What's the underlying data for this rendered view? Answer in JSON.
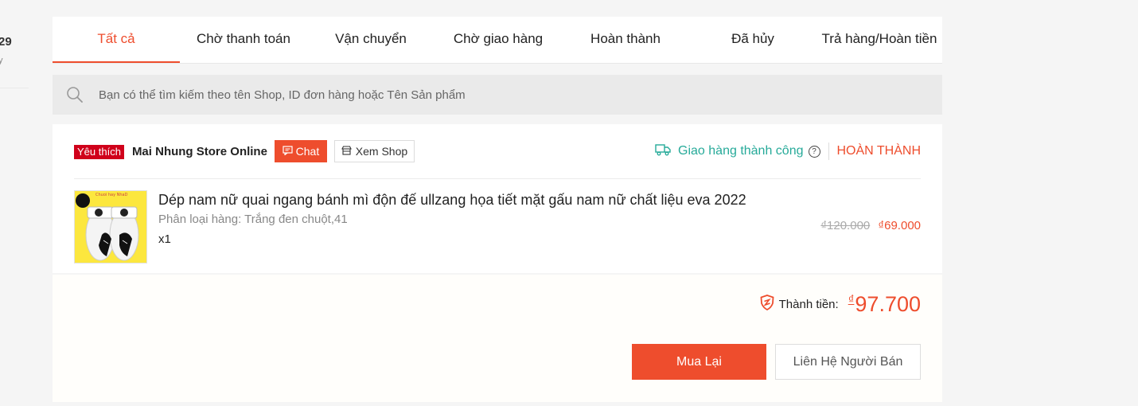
{
  "side": {
    "count": "29",
    "sub": "y"
  },
  "tabs": [
    {
      "label": "Tất cả",
      "active": true
    },
    {
      "label": "Chờ thanh toán"
    },
    {
      "label": "Vận chuyển"
    },
    {
      "label": "Chờ giao hàng"
    },
    {
      "label": "Hoàn thành"
    },
    {
      "label": "Đã hủy"
    },
    {
      "label": "Trả hàng/Hoàn tiền"
    }
  ],
  "search": {
    "placeholder": "Bạn có thể tìm kiếm theo tên Shop, ID đơn hàng hoặc Tên Sản phẩm",
    "icon": "search-icon"
  },
  "order": {
    "badge": "Yêu thích",
    "shop_name": "Mai Nhung Store Online",
    "chat_label": "Chat",
    "view_shop_label": "Xem Shop",
    "delivery_status": "Giao hàng thành công",
    "status": "HOÀN THÀNH",
    "product": {
      "name": "Dép nam nữ quai ngang bánh mì độn đế ullzang họa tiết mặt gấu nam nữ chất liệu eva 2022",
      "variant": "Phân loại hàng: Trắng đen chuột,41",
      "qty": "x1",
      "old_price": "₫120.000",
      "new_price": "₫69.000"
    },
    "total_label": "Thành tiền:",
    "total_currency": "₫",
    "total_value": "97.700",
    "buy_again": "Mua Lại",
    "contact_seller": "Liên Hệ Người Bán"
  },
  "colors": {
    "accent": "#ee4d2d",
    "success": "#26aa99",
    "badge": "#d0011b"
  }
}
